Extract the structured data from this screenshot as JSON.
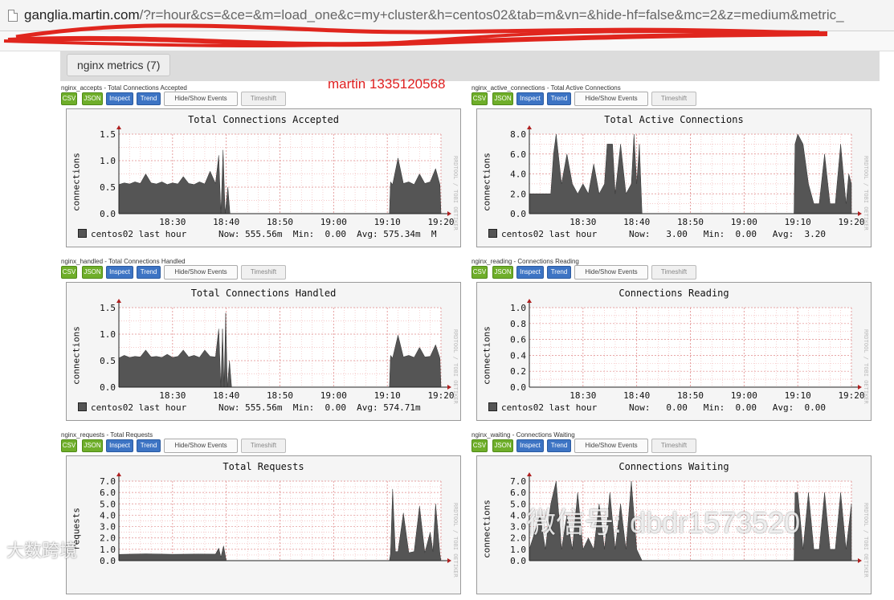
{
  "address_bar": {
    "host": "ganglia.martin.com",
    "path": "/?r=hour&cs=&ce=&m=load_one&c=my+cluster&h=centos02&tab=m&vn=&hide-hf=false&mc=2&z=medium&metric_"
  },
  "metric_group": {
    "label": "nginx metrics (7)"
  },
  "annotation": "martin 1335120568",
  "buttons": {
    "csv": "CSV",
    "json": "JSON",
    "inspect": "Inspect",
    "trend": "Trend",
    "events": "Hide/Show Events",
    "timeshift": "Timeshift"
  },
  "side_label": "RRDTOOL / TOBI OETIKER",
  "watermark": {
    "main": "微信号: dbdr1573520",
    "corner": "大数跨境"
  },
  "colors": {
    "area": "#555555",
    "grid_minor": "#f2b6b6",
    "grid_major": "#e08a8a",
    "address_scribble": "#e0261e"
  },
  "graphs": [
    {
      "caption": "nginx_accepts - Total Connections Accepted",
      "title": "Total Connections Accepted",
      "vlabel": "connections",
      "legend": {
        "host": "centos02 last hour",
        "stats": "Now: 555.56m  Min:  0.00  Avg: 575.34m  M"
      }
    },
    {
      "caption": "nginx_active_connections - Total Active Connections",
      "title": "Total Active Connections",
      "vlabel": "connections",
      "legend": {
        "host": "centos02 last hour",
        "stats": "Now:   3.00   Min:  0.00   Avg:  3.20"
      }
    },
    {
      "caption": "nginx_handled - Total Connections Handled",
      "title": "Total Connections Handled",
      "vlabel": "connections",
      "legend": {
        "host": "centos02 last hour",
        "stats": "Now: 555.56m  Min:  0.00  Avg: 574.71m"
      }
    },
    {
      "caption": "nginx_reading - Connections Reading",
      "title": "Connections Reading",
      "vlabel": "connections",
      "legend": {
        "host": "centos02 last hour",
        "stats": "Now:   0.00   Min:  0.00   Avg:  0.00"
      }
    },
    {
      "caption": "nginx_requests - Total Requests",
      "title": "Total Requests",
      "vlabel": "requests",
      "legend": {
        "host": "",
        "stats": ""
      }
    },
    {
      "caption": "nginx_waiting - Connections Waiting",
      "title": "Connections Waiting",
      "vlabel": "connections",
      "legend": {
        "host": "",
        "stats": ""
      }
    }
  ],
  "chart_data": [
    {
      "type": "area",
      "title": "Total Connections Accepted",
      "ylabel": "connections",
      "ylim": [
        0,
        1.5
      ],
      "yticks": [
        "0.0",
        "0.5",
        "1.0",
        "1.5"
      ],
      "xticks": [
        "18:30",
        "18:40",
        "18:50",
        "19:00",
        "19:10",
        "19:20"
      ],
      "xlim": [
        20,
        80
      ],
      "series": [
        {
          "name": "centos02 last hour",
          "points": [
            [
              20,
              0.55
            ],
            [
              21,
              0.58
            ],
            [
              22,
              0.56
            ],
            [
              23,
              0.6
            ],
            [
              24,
              0.57
            ],
            [
              25,
              0.75
            ],
            [
              26,
              0.58
            ],
            [
              27,
              0.56
            ],
            [
              28,
              0.6
            ],
            [
              29,
              0.55
            ],
            [
              30,
              0.58
            ],
            [
              31,
              0.56
            ],
            [
              32,
              0.7
            ],
            [
              33,
              0.57
            ],
            [
              34,
              0.55
            ],
            [
              35,
              0.6
            ],
            [
              36,
              0.56
            ],
            [
              37,
              0.8
            ],
            [
              38,
              0.57
            ],
            [
              38.6,
              1.1
            ],
            [
              39,
              0
            ],
            [
              39.4,
              1.2
            ],
            [
              39.8,
              0
            ],
            [
              40.3,
              0.5
            ],
            [
              40.7,
              0
            ],
            [
              70.4,
              0
            ],
            [
              70.6,
              0.6
            ],
            [
              71,
              0.55
            ],
            [
              72,
              1.05
            ],
            [
              73,
              0.57
            ],
            [
              74,
              0.6
            ],
            [
              75,
              0.55
            ],
            [
              76,
              0.75
            ],
            [
              77,
              0.57
            ],
            [
              78,
              0.6
            ],
            [
              79,
              0.85
            ],
            [
              79.8,
              0.55
            ],
            [
              80,
              0
            ]
          ]
        }
      ]
    },
    {
      "type": "area",
      "title": "Total Active Connections",
      "ylabel": "connections",
      "ylim": [
        0,
        8
      ],
      "yticks": [
        "0.0",
        "2.0",
        "4.0",
        "6.0",
        "8.0"
      ],
      "xticks": [
        "18:30",
        "18:40",
        "18:50",
        "19:00",
        "19:10",
        "19:20"
      ],
      "xlim": [
        20,
        80
      ],
      "series": [
        {
          "name": "centos02 last hour",
          "points": [
            [
              20,
              2
            ],
            [
              24,
              2
            ],
            [
              24.5,
              6
            ],
            [
              25,
              8
            ],
            [
              26,
              3
            ],
            [
              27,
              6
            ],
            [
              28,
              3
            ],
            [
              29,
              2
            ],
            [
              30,
              3
            ],
            [
              31,
              2
            ],
            [
              32,
              5
            ],
            [
              33,
              2
            ],
            [
              34,
              3
            ],
            [
              34.5,
              7
            ],
            [
              35.5,
              7
            ],
            [
              36,
              2
            ],
            [
              37,
              7
            ],
            [
              38,
              2
            ],
            [
              39,
              3
            ],
            [
              39.5,
              8
            ],
            [
              40,
              3
            ],
            [
              40.5,
              7
            ],
            [
              41,
              0
            ],
            [
              69.3,
              0
            ],
            [
              69.5,
              7
            ],
            [
              70,
              8
            ],
            [
              71,
              7
            ],
            [
              72,
              3
            ],
            [
              73,
              1
            ],
            [
              74,
              1
            ],
            [
              75,
              6
            ],
            [
              76,
              1
            ],
            [
              77,
              1
            ],
            [
              78,
              7
            ],
            [
              79,
              1
            ],
            [
              79.5,
              4
            ],
            [
              80,
              3
            ],
            [
              80,
              0
            ]
          ]
        }
      ]
    },
    {
      "type": "area",
      "title": "Total Connections Handled",
      "ylabel": "connections",
      "ylim": [
        0,
        1.5
      ],
      "yticks": [
        "0.0",
        "0.5",
        "1.0",
        "1.5"
      ],
      "xticks": [
        "18:30",
        "18:40",
        "18:50",
        "19:00",
        "19:10",
        "19:20"
      ],
      "xlim": [
        20,
        80
      ],
      "series": [
        {
          "name": "centos02 last hour",
          "points": [
            [
              20,
              0.55
            ],
            [
              21,
              0.6
            ],
            [
              22,
              0.56
            ],
            [
              23,
              0.58
            ],
            [
              24,
              0.57
            ],
            [
              25,
              0.7
            ],
            [
              26,
              0.57
            ],
            [
              27,
              0.58
            ],
            [
              28,
              0.56
            ],
            [
              29,
              0.62
            ],
            [
              30,
              0.56
            ],
            [
              31,
              0.58
            ],
            [
              32,
              0.7
            ],
            [
              33,
              0.57
            ],
            [
              34,
              0.6
            ],
            [
              35,
              0.56
            ],
            [
              36,
              0.7
            ],
            [
              37,
              0.58
            ],
            [
              38,
              0.57
            ],
            [
              38.6,
              1.1
            ],
            [
              39,
              0
            ],
            [
              39.3,
              1.1
            ],
            [
              39.6,
              0
            ],
            [
              39.9,
              1.4
            ],
            [
              40.2,
              0
            ],
            [
              40.6,
              0.5
            ],
            [
              41,
              0
            ],
            [
              70.4,
              0
            ],
            [
              70.6,
              0.6
            ],
            [
              71,
              0.55
            ],
            [
              72,
              0.98
            ],
            [
              73,
              0.57
            ],
            [
              74,
              0.6
            ],
            [
              75,
              0.56
            ],
            [
              76,
              0.75
            ],
            [
              77,
              0.57
            ],
            [
              78,
              0.58
            ],
            [
              79,
              0.8
            ],
            [
              79.8,
              0.55
            ],
            [
              80,
              0
            ]
          ]
        }
      ]
    },
    {
      "type": "area",
      "title": "Connections Reading",
      "ylabel": "connections",
      "ylim": [
        0,
        1.0
      ],
      "yticks": [
        "0.0",
        "0.2",
        "0.4",
        "0.6",
        "0.8",
        "1.0"
      ],
      "xticks": [
        "18:30",
        "18:40",
        "18:50",
        "19:00",
        "19:10",
        "19:20"
      ],
      "xlim": [
        20,
        80
      ],
      "series": [
        {
          "name": "centos02 last hour",
          "points": [
            [
              20,
              0
            ],
            [
              80,
              0
            ]
          ]
        }
      ]
    },
    {
      "type": "area",
      "title": "Total Requests",
      "ylabel": "requests",
      "ylim": [
        0,
        7
      ],
      "yticks": [
        "0.0",
        "1.0",
        "2.0",
        "3.0",
        "4.0",
        "5.0",
        "6.0",
        "7.0"
      ],
      "xticks": [],
      "xlim": [
        20,
        80
      ],
      "series": [
        {
          "name": "",
          "points": [
            [
              20,
              0.55
            ],
            [
              25,
              0.6
            ],
            [
              30,
              0.56
            ],
            [
              35,
              0.58
            ],
            [
              38,
              0.57
            ],
            [
              38.6,
              1.1
            ],
            [
              39,
              0.3
            ],
            [
              39.5,
              1.3
            ],
            [
              40,
              0
            ],
            [
              70.4,
              0
            ],
            [
              70.6,
              0.6
            ],
            [
              71,
              6.3
            ],
            [
              71.5,
              0.8
            ],
            [
              72,
              0.8
            ],
            [
              73,
              4.2
            ],
            [
              74,
              0.7
            ],
            [
              75,
              0.8
            ],
            [
              76,
              4.8
            ],
            [
              77,
              0.7
            ],
            [
              78,
              2.5
            ],
            [
              78.5,
              0.8
            ],
            [
              79,
              5.0
            ],
            [
              79.8,
              0.6
            ],
            [
              80,
              0
            ]
          ]
        }
      ]
    },
    {
      "type": "area",
      "title": "Connections Waiting",
      "ylabel": "connections",
      "ylim": [
        0,
        7
      ],
      "yticks": [
        "0.0",
        "1.0",
        "2.0",
        "3.0",
        "4.0",
        "5.0",
        "6.0",
        "7.0"
      ],
      "xticks": [],
      "xlim": [
        20,
        80
      ],
      "series": [
        {
          "name": "",
          "points": [
            [
              20,
              1
            ],
            [
              22,
              4
            ],
            [
              23,
              1
            ],
            [
              24,
              5
            ],
            [
              25,
              7
            ],
            [
              26,
              1
            ],
            [
              27,
              4
            ],
            [
              28,
              1
            ],
            [
              29,
              6
            ],
            [
              30,
              1
            ],
            [
              31,
              2
            ],
            [
              32,
              1
            ],
            [
              33,
              5
            ],
            [
              34,
              1
            ],
            [
              35,
              6
            ],
            [
              36,
              1
            ],
            [
              37,
              5
            ],
            [
              38,
              1
            ],
            [
              39,
              7
            ],
            [
              40,
              1
            ],
            [
              41,
              0
            ],
            [
              69.3,
              0
            ],
            [
              69.5,
              6
            ],
            [
              70,
              6
            ],
            [
              71,
              1
            ],
            [
              72,
              6
            ],
            [
              73,
              1
            ],
            [
              74,
              1
            ],
            [
              75,
              6
            ],
            [
              76,
              1
            ],
            [
              77,
              1
            ],
            [
              78,
              6
            ],
            [
              79,
              1
            ],
            [
              80,
              5
            ],
            [
              80,
              0
            ]
          ]
        }
      ]
    }
  ]
}
